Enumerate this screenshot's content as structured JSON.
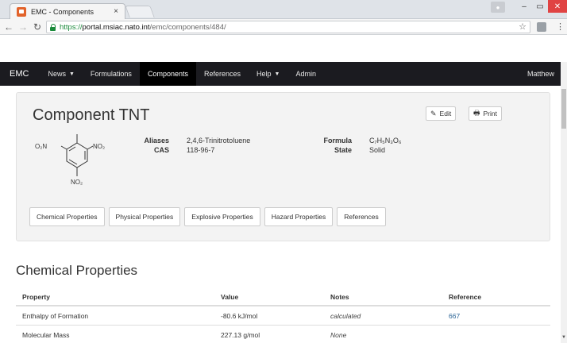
{
  "browser": {
    "tab_title": "EMC - Components",
    "tab_close": "×",
    "url_scheme": "https://",
    "url_host": "portal.msiac.nato.int",
    "url_path": "/emc/components/484/"
  },
  "navbar": {
    "brand": "EMC",
    "items": [
      {
        "label": "News",
        "dropdown": true
      },
      {
        "label": "Formulations",
        "dropdown": false
      },
      {
        "label": "Components",
        "dropdown": false,
        "active": true
      },
      {
        "label": "References",
        "dropdown": false
      },
      {
        "label": "Help",
        "dropdown": true
      },
      {
        "label": "Admin",
        "dropdown": false
      }
    ],
    "user": "Matthew"
  },
  "component": {
    "title": "Component TNT",
    "edit_label": "Edit",
    "print_label": "Print",
    "aliases_label": "Aliases",
    "aliases_value": "2,4,6-Trinitrotoluene",
    "cas_label": "CAS",
    "cas_value": "118-96-7",
    "formula_label": "Formula",
    "formula_value": "C₇H₅N₃O₆",
    "state_label": "State",
    "state_value": "Solid",
    "structure_labels": {
      "left": "O₂N",
      "right": "NO₂",
      "bottom": "NO₂"
    },
    "tabs": [
      "Chemical Properties",
      "Physical Properties",
      "Explosive Properties",
      "Hazard Properties",
      "References"
    ]
  },
  "chemical_properties": {
    "title": "Chemical Properties",
    "headers": [
      "Property",
      "Value",
      "Notes",
      "Reference"
    ],
    "rows": [
      {
        "property": "Enthalpy of Formation",
        "value": "-80.6 kJ/mol",
        "notes": "calculated",
        "reference": "667"
      },
      {
        "property": "Molecular Mass",
        "value": "227.13 g/mol",
        "notes": "None",
        "reference": ""
      }
    ]
  },
  "colors": {
    "navbar_bg": "#1b1b20",
    "link": "#2a6496",
    "panel_bg": "#f3f3f3",
    "close_btn": "#e04343"
  }
}
